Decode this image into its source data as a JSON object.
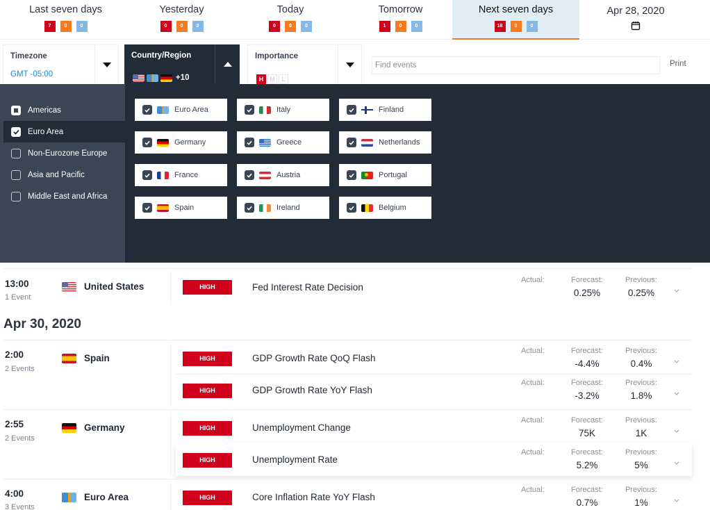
{
  "day_tabs": [
    {
      "label": "Last seven days",
      "high": "7",
      "medium": "0",
      "low": "0",
      "active": false
    },
    {
      "label": "Yesterday",
      "high": "0",
      "medium": "0",
      "low": "0",
      "active": false
    },
    {
      "label": "Today",
      "high": "0",
      "medium": "0",
      "low": "0",
      "active": false
    },
    {
      "label": "Tomorrow",
      "high": "1",
      "medium": "0",
      "low": "0",
      "active": false
    },
    {
      "label": "Next seven days",
      "high": "18",
      "medium": "0",
      "low": "0",
      "active": true
    },
    {
      "label": "Apr 28, 2020",
      "icon": "calendar-icon"
    }
  ],
  "colors": {
    "high": "#d0021b",
    "medium": "#f47b20",
    "low": "#84b9e6",
    "panel_dark": "#222b38",
    "panel_side": "#3a4556",
    "active_tab_bg": "#e1edf4",
    "active_tab_underline": "#f07b27",
    "link_blue": "#1f8ac8"
  },
  "filters": {
    "timezone": {
      "title": "Timezone",
      "value": "GMT -05:00"
    },
    "country": {
      "title": "Country/Region",
      "flags": [
        "United States",
        "Euro Area",
        "Germany"
      ],
      "more": "+10"
    },
    "importance": {
      "title": "Importance",
      "options": [
        "H",
        "M",
        "L"
      ],
      "selected": "H"
    },
    "search": {
      "placeholder": "Find events",
      "value": ""
    },
    "print_label": "Print"
  },
  "regions": [
    {
      "label": "Americas",
      "state": "partial"
    },
    {
      "label": "Euro Area",
      "state": "checked"
    },
    {
      "label": "Non-Eurozone Europe",
      "state": "unchecked"
    },
    {
      "label": "Asia and Pacific",
      "state": "unchecked"
    },
    {
      "label": "Middle East and Africa",
      "state": "unchecked"
    }
  ],
  "countries": [
    {
      "label": "Euro Area",
      "checked": true
    },
    {
      "label": "Italy",
      "checked": true
    },
    {
      "label": "Finland",
      "checked": true
    },
    {
      "label": "Germany",
      "checked": true
    },
    {
      "label": "Greece",
      "checked": true
    },
    {
      "label": "Netherlands",
      "checked": true
    },
    {
      "label": "France",
      "checked": true
    },
    {
      "label": "Austria",
      "checked": true
    },
    {
      "label": "Portugal",
      "checked": true
    },
    {
      "label": "Spain",
      "checked": true
    },
    {
      "label": "Ireland",
      "checked": true
    },
    {
      "label": "Belgium",
      "checked": true
    }
  ],
  "labels": {
    "actual": "Actual:",
    "forecast": "Forecast:",
    "previous": "Previous:",
    "importance_high": "HIGH"
  },
  "events": {
    "group_us": {
      "time": "13:00",
      "count": "1 Event",
      "country": "United States",
      "items": [
        {
          "name": "Fed Interest Rate Decision",
          "importance": "HIGH",
          "actual": "",
          "forecast": "0.25%",
          "previous": "0.25%"
        }
      ]
    },
    "day2_date": "Apr 30, 2020",
    "group_es": {
      "time": "2:00",
      "count": "2 Events",
      "country": "Spain",
      "items": [
        {
          "name": "GDP Growth Rate QoQ Flash",
          "importance": "HIGH",
          "actual": "",
          "forecast": "-4.4%",
          "previous": "0.4%"
        },
        {
          "name": "GDP Growth Rate YoY Flash",
          "importance": "HIGH",
          "actual": "",
          "forecast": "-3.2%",
          "previous": "1.8%"
        }
      ]
    },
    "group_de": {
      "time": "2:55",
      "count": "2 Events",
      "country": "Germany",
      "items": [
        {
          "name": "Unemployment Change",
          "importance": "HIGH",
          "actual": "",
          "forecast": "75K",
          "previous": "1K"
        },
        {
          "name": "Unemployment Rate",
          "importance": "HIGH",
          "actual": "",
          "forecast": "5.2%",
          "previous": "5%"
        }
      ]
    },
    "group_ea": {
      "time": "4:00",
      "count": "3 Events",
      "country": "Euro Area",
      "items": [
        {
          "name": "Core Inflation Rate YoY Flash",
          "importance": "HIGH",
          "actual": "",
          "forecast": "0.7%",
          "previous": "1%"
        }
      ]
    }
  }
}
